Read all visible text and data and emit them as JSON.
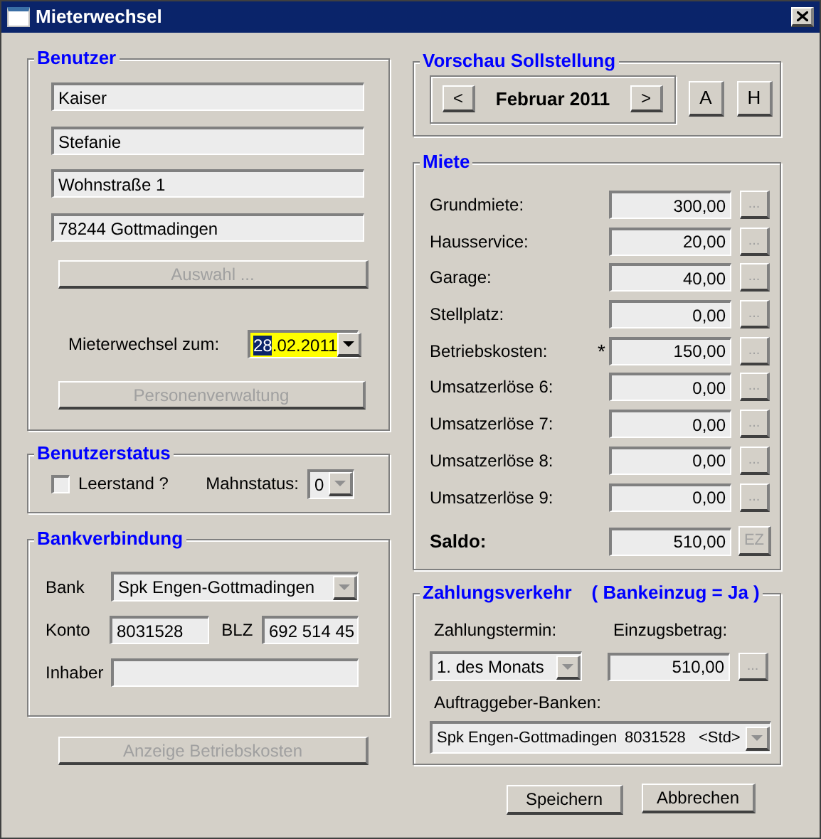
{
  "window": {
    "title": "Mieterwechsel"
  },
  "benutzer": {
    "title": "Benutzer",
    "fields": [
      "Kaiser",
      "Stefanie",
      "Wohnstraße 1",
      "78244 Gottmadingen"
    ],
    "select_button": {
      "label": "Auswahl ...",
      "disabled": true
    },
    "date_label": "Mieterwechsel zum:",
    "date_selected_part": "28",
    "date_rest": ".02.2011",
    "personen_button": {
      "label": "Personenverwaltung",
      "disabled": true
    }
  },
  "status": {
    "title": "Benutzerstatus",
    "leerstand": {
      "label": "Leerstand ?",
      "checked": false
    },
    "mahnstatus_label": "Mahnstatus:",
    "mahnstatus": "0"
  },
  "bank": {
    "title": "Bankverbindung",
    "bank_label": "Bank",
    "bank": "Spk Engen-Gottmadingen",
    "konto_label": "Konto",
    "konto": "8031528",
    "blz_label": "BLZ",
    "blz": "692 514 45",
    "inhaber_label": "Inhaber"
  },
  "betriebskosten_button": {
    "label": "Anzeige Betriebskosten",
    "disabled": true
  },
  "vorschau": {
    "title": "Vorschau Sollstellung",
    "prev": "<",
    "month": "Februar 2011",
    "next": ">",
    "buttons": [
      "A",
      "H"
    ]
  },
  "miete": {
    "title": "Miete",
    "rows": [
      {
        "label": "Grundmiete:",
        "value": "300,00",
        "button": "..."
      },
      {
        "label": "Hausservice:",
        "value": "20,00",
        "button": "..."
      },
      {
        "label": "Garage:",
        "value": "40,00",
        "button": "..."
      },
      {
        "label": "Stellplatz:",
        "value": "0,00",
        "button": "..."
      },
      {
        "label": "Betriebskosten:",
        "note": "*",
        "value": "150,00",
        "button": "..."
      },
      {
        "label": "Umsatzerlöse 6:",
        "value": "0,00",
        "button": "..."
      },
      {
        "label": "Umsatzerlöse 7:",
        "value": "0,00",
        "button": "..."
      },
      {
        "label": "Umsatzerlöse 8:",
        "value": "0,00",
        "button": "..."
      },
      {
        "label": "Umsatzerlöse 9:",
        "value": "0,00",
        "button": "..."
      }
    ],
    "saldo": {
      "label": "Saldo:",
      "value": "510,00",
      "button": "EZ"
    }
  },
  "zahlung": {
    "title": "Zahlungsverkehr",
    "title_note": "( Bankeinzug = Ja )",
    "termin_label": "Zahlungstermin:",
    "termin": "1. des Monats",
    "betrag_label": "Einzugsbetrag:",
    "betrag": "510,00",
    "betrag_button": "...",
    "banken_label": "Auftraggeber-Banken:",
    "bank": "Spk Engen-Gottmadingen",
    "konto": "8031528",
    "std": "<Std>"
  },
  "buttons": [
    "Speichern",
    "Abbrechen"
  ]
}
